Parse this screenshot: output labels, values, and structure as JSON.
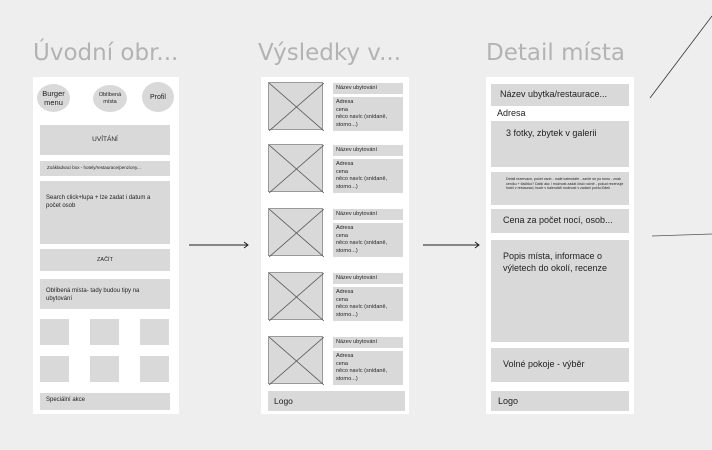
{
  "titles": {
    "home": "Úvodní obr...",
    "results": "Výsledky v...",
    "detail": "Detail místa"
  },
  "home": {
    "burger": "Burger menu",
    "favorites": "Oblíbená místa",
    "profile": "Profil",
    "welcome": "UVÍTÁNÍ",
    "search_box": "Zoákladvaci box - hotely/restaurace/penziony...",
    "search_desc": "Search click+lupa + lze zadat i datum a počet osob",
    "start": "ZAČÍT",
    "fav_places": "Oblíbená místa- tady budou tipy na ubytování",
    "special": "Speciální akce"
  },
  "results": {
    "cards": [
      {
        "name": "Název ubytování",
        "lines": [
          "Adresa",
          "cena",
          "něco navíc (snídaně, storno...)"
        ]
      },
      {
        "name": "Název ubytování",
        "lines": [
          "Adresa",
          "cena",
          "něco navíc (snídaně, storno...)"
        ]
      },
      {
        "name": "Název ubytování",
        "lines": [
          "Adresa",
          "cena",
          "něco navíc (snídaně, storno...)"
        ]
      },
      {
        "name": "Název ubytování",
        "lines": [
          "Adresa",
          "cena",
          "něco navíc (snídaně, storno...)"
        ]
      },
      {
        "name": "Název ubytování",
        "lines": [
          "Adresa",
          "cena",
          "něco navíc (snídaně, storno...)"
        ]
      }
    ],
    "logo": "Logo"
  },
  "detail": {
    "name": "Název ubytka/restaurace...",
    "address": "Adresa",
    "photos": "3 fotky, zbytek v galerii",
    "small_text": "Detail rezervace, počet osob - malé kalendáře - zavře se po tomu - znak ceníku + tlačítko? Další akc / možnost zadat číslo ručně - pokud rezervuje hotel v restauraci, bude v kalendáři možnost v zadání počtu lůžek",
    "price": "Cena za počet nocí, osob...",
    "description": "Popis místa, informace o výletech do okolí, recenze",
    "rooms": "Volné pokoje - výběr",
    "logo": "Logo"
  },
  "colors": {
    "background": "#eeeeee",
    "frame": "#ffffff",
    "box": "#d9d9d9",
    "title": "#b3b3b3"
  }
}
